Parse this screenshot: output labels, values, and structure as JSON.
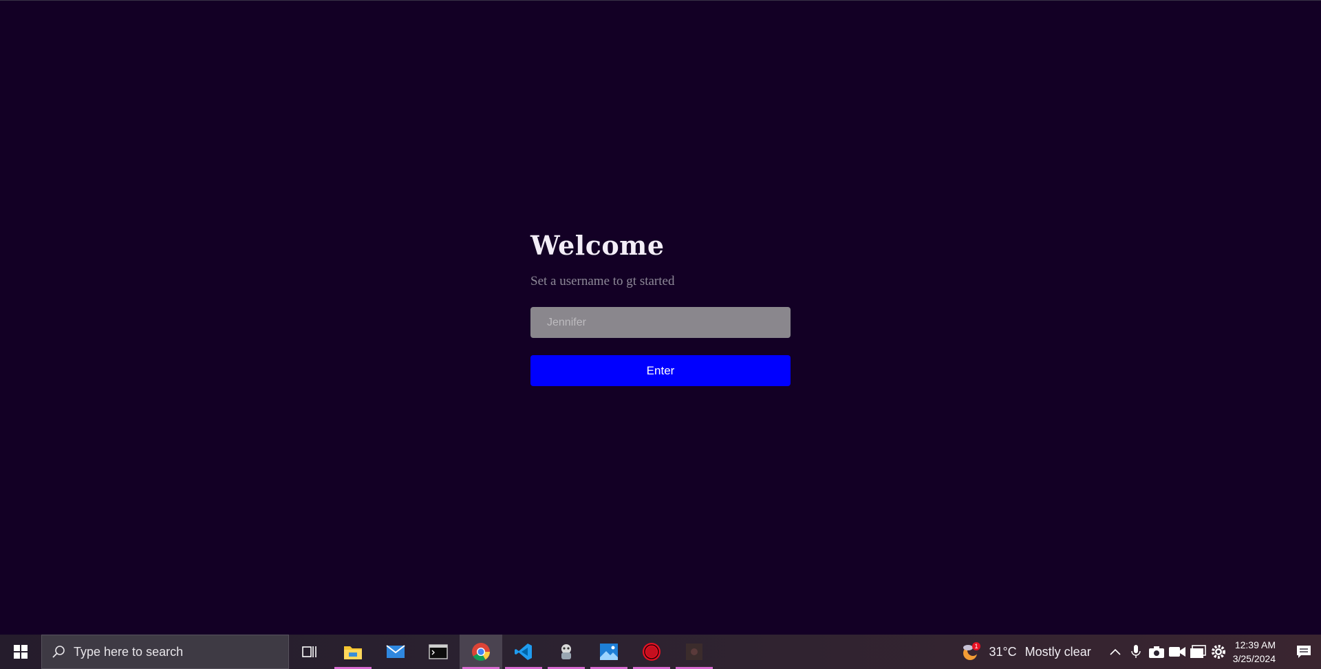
{
  "welcome": {
    "title": "Welcome",
    "subtitle": "Set a username to gt started",
    "input_placeholder": "Jennifer",
    "input_value": "",
    "button_label": "Enter"
  },
  "colors": {
    "background": "#130025",
    "button": "#0000ff",
    "input": "#8a878d",
    "taskbar_indicator": "#d86bd1"
  },
  "taskbar": {
    "search_placeholder": "Type here to search",
    "apps": [
      {
        "name": "task-view-icon",
        "open": false
      },
      {
        "name": "file-explorer-icon",
        "open": true
      },
      {
        "name": "mail-icon",
        "open": false
      },
      {
        "name": "terminal-icon",
        "open": false
      },
      {
        "name": "chrome-icon",
        "open": true,
        "active": true
      },
      {
        "name": "vscode-icon",
        "open": true
      },
      {
        "name": "app-icon",
        "open": true
      },
      {
        "name": "photos-icon",
        "open": true
      },
      {
        "name": "record-icon",
        "open": true
      },
      {
        "name": "media-icon",
        "open": true
      }
    ],
    "weather": {
      "temperature": "31°C",
      "condition": "Mostly clear",
      "badge": "1"
    },
    "clock": {
      "time": "12:39 AM",
      "date": "3/25/2024"
    }
  }
}
